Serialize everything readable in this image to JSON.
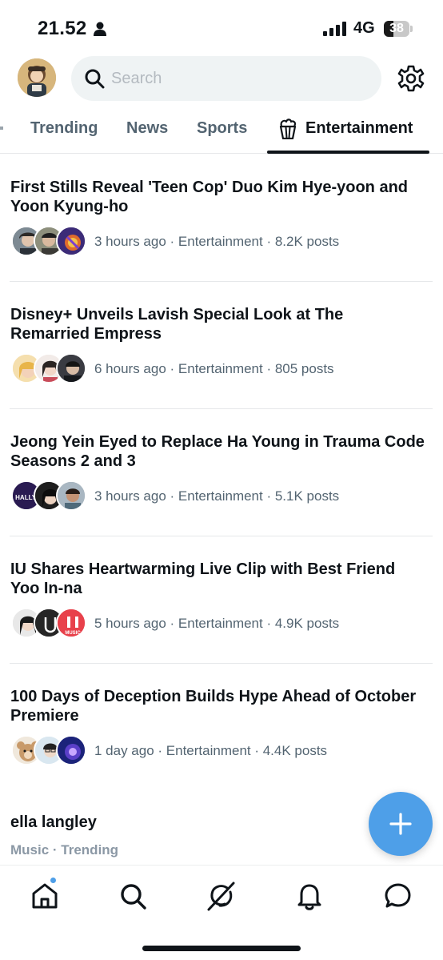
{
  "status_bar": {
    "time": "21.52",
    "network": "4G",
    "battery": "38"
  },
  "search": {
    "placeholder": "Search"
  },
  "tabs": [
    {
      "label": "Trending",
      "active": false
    },
    {
      "label": "News",
      "active": false
    },
    {
      "label": "Sports",
      "active": false
    },
    {
      "label": "Entertainment",
      "active": true,
      "icon": "popcorn-icon"
    }
  ],
  "feed": [
    {
      "title": "First Stills Reveal 'Teen Cop' Duo Kim Hye-yoon and Yoon Kyung-ho",
      "meta": "3 hours ago · Entertainment · 8.2K posts"
    },
    {
      "title": "Disney+ Unveils Lavish Special Look at The Remarried Empress",
      "meta": "6 hours ago · Entertainment · 805 posts"
    },
    {
      "title": "Jeong Yein Eyed to Replace Ha Young in Trauma Code Seasons 2 and 3",
      "meta": "3 hours ago · Entertainment · 5.1K posts"
    },
    {
      "title": "IU Shares Heartwarming Live Clip with Best Friend Yoo In-na",
      "meta": "5 hours ago · Entertainment · 4.9K posts"
    },
    {
      "title": "100 Days of Deception Builds Hype Ahead of October Premiere",
      "meta": "1 day ago · Entertainment · 4.4K posts"
    }
  ],
  "trend": {
    "name": "ella langley",
    "meta": "Music · Trending"
  },
  "avatar_text": {
    "hallyu": "HALLYU",
    "music": "MUSIC"
  },
  "colors": {
    "accent": "#4e9fe8",
    "text": "#0f1419",
    "secondary": "#536471"
  },
  "bottom_nav": [
    {
      "icon": "home-icon",
      "active": true,
      "notification_dot": true
    },
    {
      "icon": "search-icon"
    },
    {
      "icon": "grok-icon"
    },
    {
      "icon": "bell-icon"
    },
    {
      "icon": "messages-icon"
    }
  ]
}
